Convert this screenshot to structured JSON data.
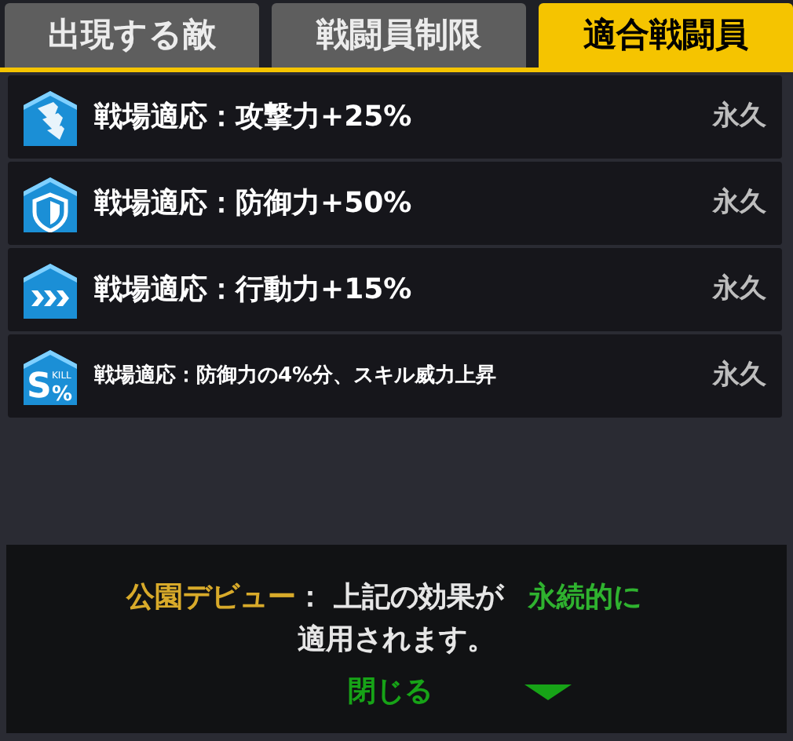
{
  "tabs": [
    {
      "label": "出現する敵",
      "selected": false
    },
    {
      "label": "戦闘員制限",
      "selected": false
    },
    {
      "label": "適合戦闘員",
      "selected": true
    }
  ],
  "effects": [
    {
      "kind": "attack",
      "name": "戦場適応：攻撃力+25%",
      "duration": "永久"
    },
    {
      "kind": "defense",
      "name": "戦場適応：防御力+50%",
      "duration": "永久"
    },
    {
      "kind": "speed",
      "name": "戦場適応：行動力+15%",
      "duration": "永久"
    },
    {
      "kind": "skill",
      "icon_label": "S%",
      "icon_caption": "KILL",
      "name": "戦場適応：防御力の4%分、スキル威力上昇",
      "duration": "永久",
      "small": true
    }
  ],
  "notice": {
    "message": [
      {
        "color": "#d8aa2a",
        "text": "公園デビュー"
      },
      {
        "color": "#e6e6e6",
        "text": "： 上記の効果が"
      },
      {
        "color": "#2fb22f",
        "text": "永続的に"
      },
      {
        "color": "#e6e6e6",
        "text": "適用されます。"
      }
    ],
    "close_label": "閉じる"
  }
}
